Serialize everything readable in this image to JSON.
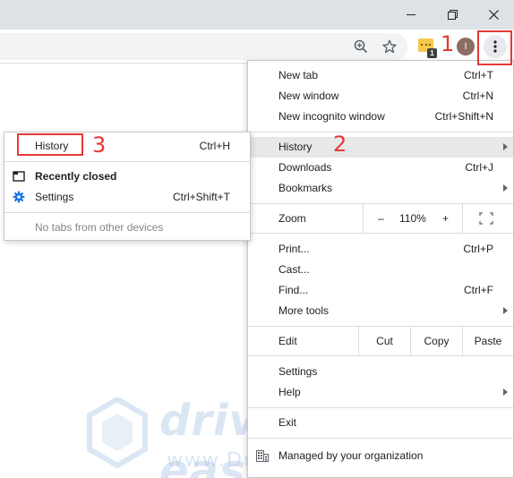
{
  "menu": {
    "new_tab": {
      "label": "New tab",
      "shortcut": "Ctrl+T"
    },
    "new_window": {
      "label": "New window",
      "shortcut": "Ctrl+N"
    },
    "new_incognito": {
      "label": "New incognito window",
      "shortcut": "Ctrl+Shift+N"
    },
    "history": {
      "label": "History"
    },
    "downloads": {
      "label": "Downloads",
      "shortcut": "Ctrl+J"
    },
    "bookmarks": {
      "label": "Bookmarks"
    },
    "zoom": {
      "label": "Zoom",
      "minus": "–",
      "level": "110%",
      "plus": "+"
    },
    "print": {
      "label": "Print...",
      "shortcut": "Ctrl+P"
    },
    "cast": {
      "label": "Cast..."
    },
    "find": {
      "label": "Find...",
      "shortcut": "Ctrl+F"
    },
    "more_tools": {
      "label": "More tools"
    },
    "edit": {
      "label": "Edit",
      "cut": "Cut",
      "copy": "Copy",
      "paste": "Paste"
    },
    "settings": {
      "label": "Settings"
    },
    "help": {
      "label": "Help"
    },
    "exit": {
      "label": "Exit"
    },
    "managed": {
      "label": "Managed by your organization"
    }
  },
  "submenu": {
    "history": {
      "label": "History",
      "shortcut": "Ctrl+H"
    },
    "recently_closed": {
      "label": "Recently closed"
    },
    "settings": {
      "label": "Settings",
      "shortcut": "Ctrl+Shift+T"
    },
    "no_tabs": {
      "label": "No tabs from other devices"
    }
  },
  "toolbar": {
    "extension_badge": "1",
    "avatar_initial": "I"
  },
  "annotations": {
    "step1": "1",
    "step2": "2",
    "step3": "3"
  },
  "watermark": {
    "brand": "driver easy",
    "url": "www.DriverEasy.com"
  },
  "colors": {
    "annotation_red": "#e53935",
    "highlight": "#e8e8e8",
    "title_bar": "#dee1e6"
  },
  "icons": [
    "minimize-icon",
    "maximize-icon",
    "close-icon",
    "zoom-icon",
    "star-icon",
    "extension-icon",
    "more-vert-icon",
    "fullscreen-icon",
    "building-icon",
    "tab-icon",
    "gear-icon"
  ]
}
